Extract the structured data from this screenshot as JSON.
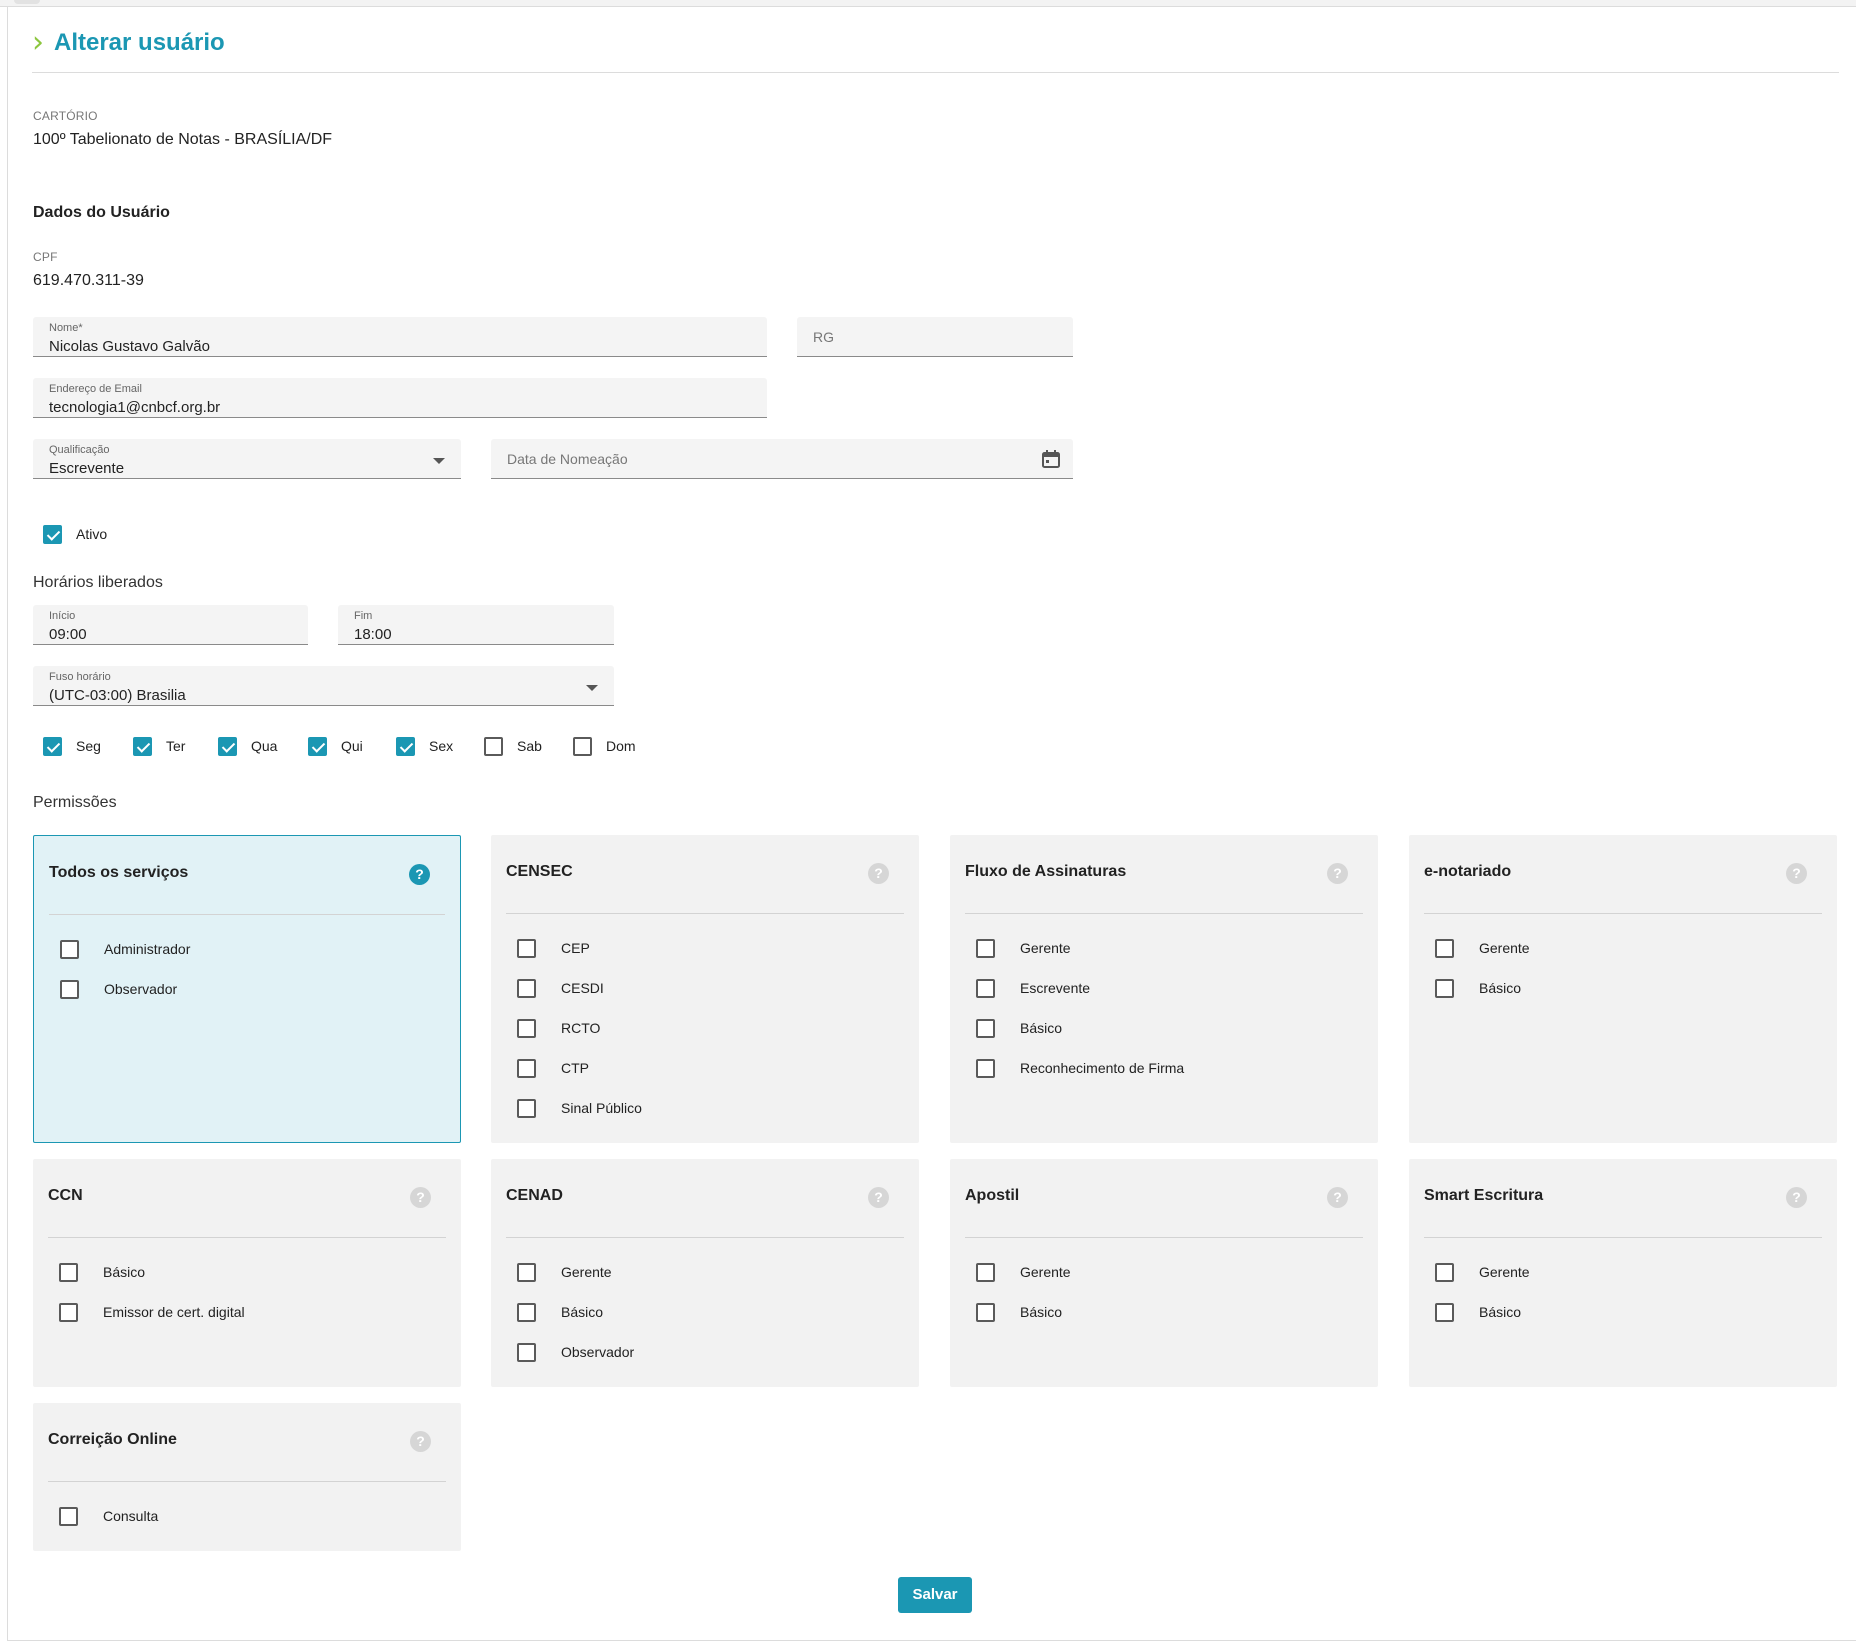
{
  "page": {
    "title": "Alterar usuário"
  },
  "cartorio": {
    "label": "CARTÓRIO",
    "value": "100º Tabelionato de Notas - BRASÍLIA/DF"
  },
  "user_section": {
    "heading": "Dados do Usuário",
    "cpf_label": "CPF",
    "cpf_value": "619.470.311-39",
    "nome_label": "Nome*",
    "nome_value": "Nicolas Gustavo Galvão",
    "rg_placeholder": "RG",
    "email_label": "Endereço de Email",
    "email_value": "tecnologia1@cnbcf.org.br",
    "qualificacao_label": "Qualificação",
    "qualificacao_value": "Escrevente",
    "data_nomeacao_placeholder": "Data de Nomeação",
    "ativo_label": "Ativo",
    "ativo_checked": true
  },
  "horarios": {
    "heading": "Horários liberados",
    "inicio_label": "Início",
    "inicio_value": "09:00",
    "fim_label": "Fim",
    "fim_value": "18:00",
    "fuso_label": "Fuso horário",
    "fuso_value": "(UTC-03:00) Brasilia",
    "days": [
      {
        "label": "Seg",
        "checked": true
      },
      {
        "label": "Ter",
        "checked": true
      },
      {
        "label": "Qua",
        "checked": true
      },
      {
        "label": "Qui",
        "checked": true
      },
      {
        "label": "Sex",
        "checked": true
      },
      {
        "label": "Sab",
        "checked": false
      },
      {
        "label": "Dom",
        "checked": false
      }
    ]
  },
  "permissoes": {
    "heading": "Permissões",
    "help_glyph": "?",
    "cards": [
      {
        "title": "Todos os serviços",
        "active": true,
        "items": [
          "Administrador",
          "Observador"
        ]
      },
      {
        "title": "CENSEC",
        "active": false,
        "items": [
          "CEP",
          "CESDI",
          "RCTO",
          "CTP",
          "Sinal Público"
        ]
      },
      {
        "title": "Fluxo de Assinaturas",
        "active": false,
        "items": [
          "Gerente",
          "Escrevente",
          "Básico",
          "Reconhecimento de Firma"
        ]
      },
      {
        "title": "e-notariado",
        "active": false,
        "items": [
          "Gerente",
          "Básico"
        ]
      },
      {
        "title": "CCN",
        "active": false,
        "items": [
          "Básico",
          "Emissor de cert. digital"
        ]
      },
      {
        "title": "CENAD",
        "active": false,
        "items": [
          "Gerente",
          "Básico",
          "Observador"
        ]
      },
      {
        "title": "Apostil",
        "active": false,
        "items": [
          "Gerente",
          "Básico"
        ]
      },
      {
        "title": "Smart Escritura",
        "active": false,
        "items": [
          "Gerente",
          "Básico"
        ]
      },
      {
        "title": "Correição Online",
        "active": false,
        "items": [
          "Consulta"
        ]
      }
    ]
  },
  "actions": {
    "save_label": "Salvar"
  },
  "colors": {
    "accent": "#1b97b3",
    "chevron": "#8cc63e",
    "card_bg": "#f2f2f2",
    "card_active_bg": "#e1f2f6"
  }
}
